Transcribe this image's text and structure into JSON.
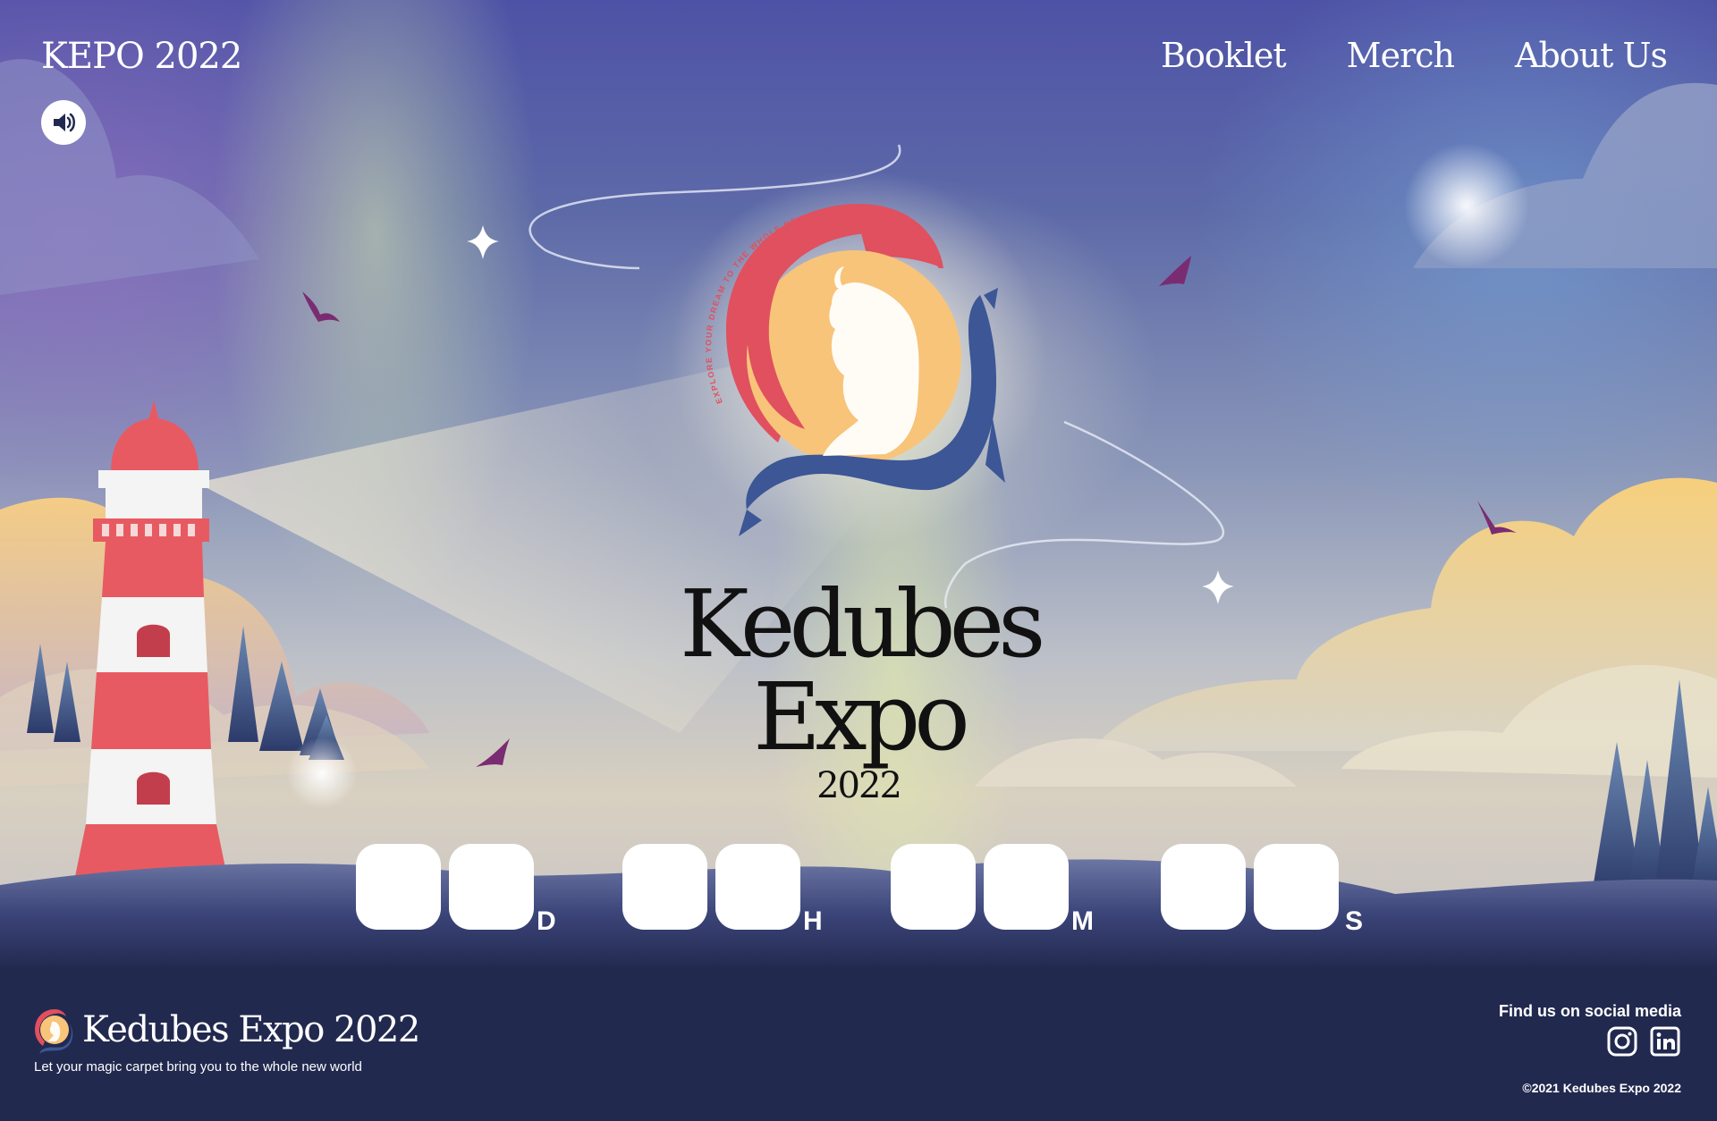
{
  "header": {
    "brand": "KEPO 2022",
    "nav": [
      {
        "label": "Booklet"
      },
      {
        "label": "Merch"
      },
      {
        "label": "About Us"
      }
    ],
    "sound_icon": "speaker-icon"
  },
  "hero": {
    "logo_arc_text": "EXPLORE YOUR DREAM TO THE WHOLE NEW WORLD",
    "title_line1": "Kedubes",
    "title_line2": "Expo",
    "year": "2022"
  },
  "countdown": {
    "units": {
      "days": "D",
      "hours": "H",
      "minutes": "M",
      "seconds": "S"
    }
  },
  "footer": {
    "title": "Kedubes Expo 2022",
    "tagline": "Let your magic carpet bring you to the whole new world",
    "social_label": "Find us on social media",
    "social_icons": [
      "instagram-icon",
      "linkedin-icon"
    ],
    "copyright": "©2021 Kedubes Expo 2022"
  },
  "colors": {
    "footer_bg": "#22294f",
    "logo_red": "#e0505e",
    "logo_sun": "#f8c47a",
    "logo_blue": "#3c5696",
    "lighthouse_red": "#e85a62"
  }
}
